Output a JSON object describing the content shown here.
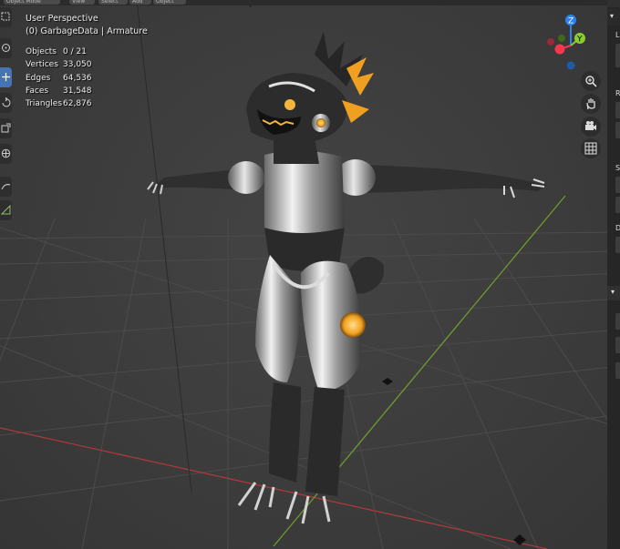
{
  "header": {
    "mode": "Object Mode",
    "menus": [
      "View",
      "Select",
      "Add",
      "Object"
    ]
  },
  "viewport": {
    "view_name": "User Perspective",
    "collection_line": "(0) GarbageData | Armature",
    "stats": [
      {
        "label": "Objects",
        "value": "0 / 21"
      },
      {
        "label": "Vertices",
        "value": "33,050"
      },
      {
        "label": "Edges",
        "value": "64,536"
      },
      {
        "label": "Faces",
        "value": "31,548"
      },
      {
        "label": "Triangles",
        "value": "62,876"
      }
    ]
  },
  "gizmo": {
    "z_label": "Z",
    "y_label": "Y",
    "colors": {
      "x": "#f5374f",
      "y": "#8bcf2f",
      "z": "#2b83f0"
    }
  },
  "toolbar": {
    "tools": [
      "select-box-icon",
      "cursor-icon",
      "move-icon",
      "rotate-icon",
      "scale-icon",
      "transform-icon",
      "annotate-icon",
      "measure-icon"
    ],
    "active_index": 2
  },
  "nav_buttons": [
    "zoom-icon",
    "hand-icon",
    "camera-icon",
    "grid-icon"
  ],
  "right_panel": {
    "letters": [
      "L",
      "R",
      "S",
      "D"
    ]
  },
  "colors": {
    "axis_x": "#a83a3a",
    "axis_y": "#6e9a2c",
    "accent_orange": "#f0a020",
    "active_tool": "#4772b3"
  }
}
